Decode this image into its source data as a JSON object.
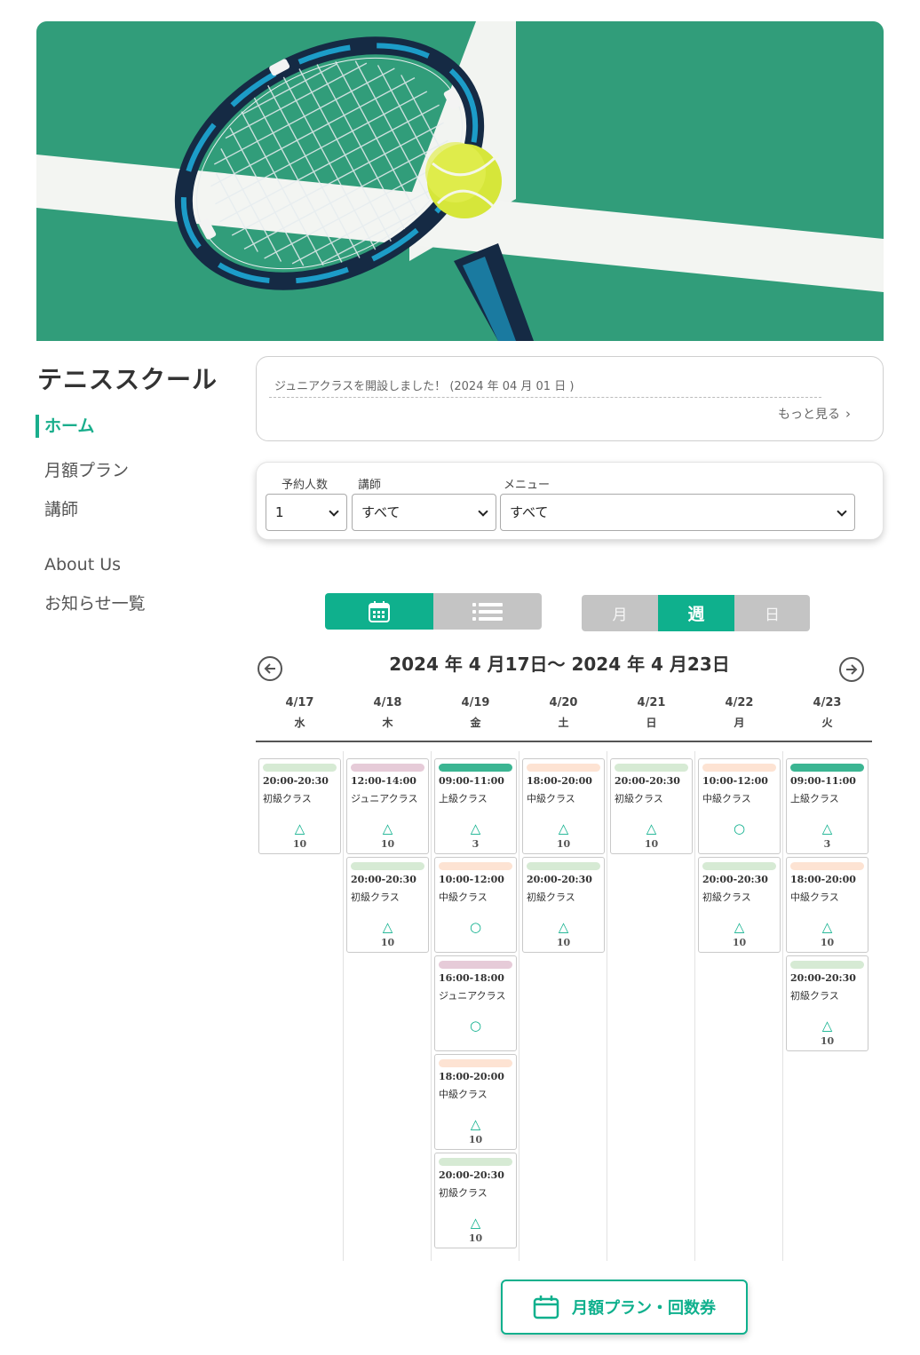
{
  "hero": {
    "image": "tennis-racket-and-ball-on-court"
  },
  "site": {
    "title": "テニススクール"
  },
  "nav": {
    "items": [
      {
        "label": "ホーム",
        "active": true
      },
      {
        "label": "月額プラン"
      },
      {
        "label": "講師"
      },
      {
        "label": "About Us"
      },
      {
        "label": "お知らせ一覧"
      }
    ]
  },
  "news": {
    "item": "ジュニアクラスを開設しました！ (2024 年 04 月 01 日 )",
    "more": "もっと見る"
  },
  "filter": {
    "people_label": "予約人数",
    "people_value": "1",
    "instructor_label": "講師",
    "instructor_value": "すべて",
    "menu_label": "メニュー",
    "menu_value": "すべて"
  },
  "view": {
    "modes": [
      {
        "icon": "calendar-icon",
        "active": true
      },
      {
        "icon": "list-icon",
        "active": false
      }
    ],
    "periods": [
      {
        "label": "月",
        "active": false
      },
      {
        "label": "週",
        "active": true
      },
      {
        "label": "日",
        "active": false
      }
    ]
  },
  "week": {
    "title": "2024 年 4 月17日〜 2024 年 4 月23日",
    "days": [
      {
        "date": "4/17",
        "dow": "水"
      },
      {
        "date": "4/18",
        "dow": "木"
      },
      {
        "date": "4/19",
        "dow": "金"
      },
      {
        "date": "4/20",
        "dow": "土"
      },
      {
        "date": "4/21",
        "dow": "日"
      },
      {
        "date": "4/22",
        "dow": "月"
      },
      {
        "date": "4/23",
        "dow": "火"
      }
    ]
  },
  "colors": {
    "accent": "#0fb08d",
    "beginner": "#d6ead4",
    "junior": "#e6cbd8",
    "advanced": "#3bb592",
    "intermediate": "#fde3d3"
  },
  "schedule": [
    [
      {
        "time": "20:00-20:30",
        "name": "初級クラス",
        "level": "beginner",
        "mark": "△",
        "count": "10"
      }
    ],
    [
      {
        "time": "12:00-14:00",
        "name": "ジュニアクラス",
        "level": "junior",
        "mark": "△",
        "count": "10"
      },
      {
        "time": "20:00-20:30",
        "name": "初級クラス",
        "level": "beginner",
        "mark": "△",
        "count": "10"
      }
    ],
    [
      {
        "time": "09:00-11:00",
        "name": "上級クラス",
        "level": "advanced",
        "mark": "△",
        "count": "3"
      },
      {
        "time": "10:00-12:00",
        "name": "中級クラス",
        "level": "intermediate",
        "mark": "○",
        "count": ""
      },
      {
        "time": "16:00-18:00",
        "name": "ジュニアクラス",
        "level": "junior",
        "mark": "○",
        "count": ""
      },
      {
        "time": "18:00-20:00",
        "name": "中級クラス",
        "level": "intermediate",
        "mark": "△",
        "count": "10"
      },
      {
        "time": "20:00-20:30",
        "name": "初級クラス",
        "level": "beginner",
        "mark": "△",
        "count": "10"
      }
    ],
    [
      {
        "time": "18:00-20:00",
        "name": "中級クラス",
        "level": "intermediate",
        "mark": "△",
        "count": "10"
      },
      {
        "time": "20:00-20:30",
        "name": "初級クラス",
        "level": "beginner",
        "mark": "△",
        "count": "10"
      }
    ],
    [
      {
        "time": "20:00-20:30",
        "name": "初級クラス",
        "level": "beginner",
        "mark": "△",
        "count": "10"
      }
    ],
    [
      {
        "time": "10:00-12:00",
        "name": "中級クラス",
        "level": "intermediate",
        "mark": "○",
        "count": ""
      },
      {
        "time": "20:00-20:30",
        "name": "初級クラス",
        "level": "beginner",
        "mark": "△",
        "count": "10"
      }
    ],
    [
      {
        "time": "09:00-11:00",
        "name": "上級クラス",
        "level": "advanced",
        "mark": "△",
        "count": "3"
      },
      {
        "time": "18:00-20:00",
        "name": "中級クラス",
        "level": "intermediate",
        "mark": "△",
        "count": "10"
      },
      {
        "time": "20:00-20:30",
        "name": "初級クラス",
        "level": "beginner",
        "mark": "△",
        "count": "10"
      }
    ]
  ],
  "cta": {
    "label": "月額プラン・回数券"
  }
}
